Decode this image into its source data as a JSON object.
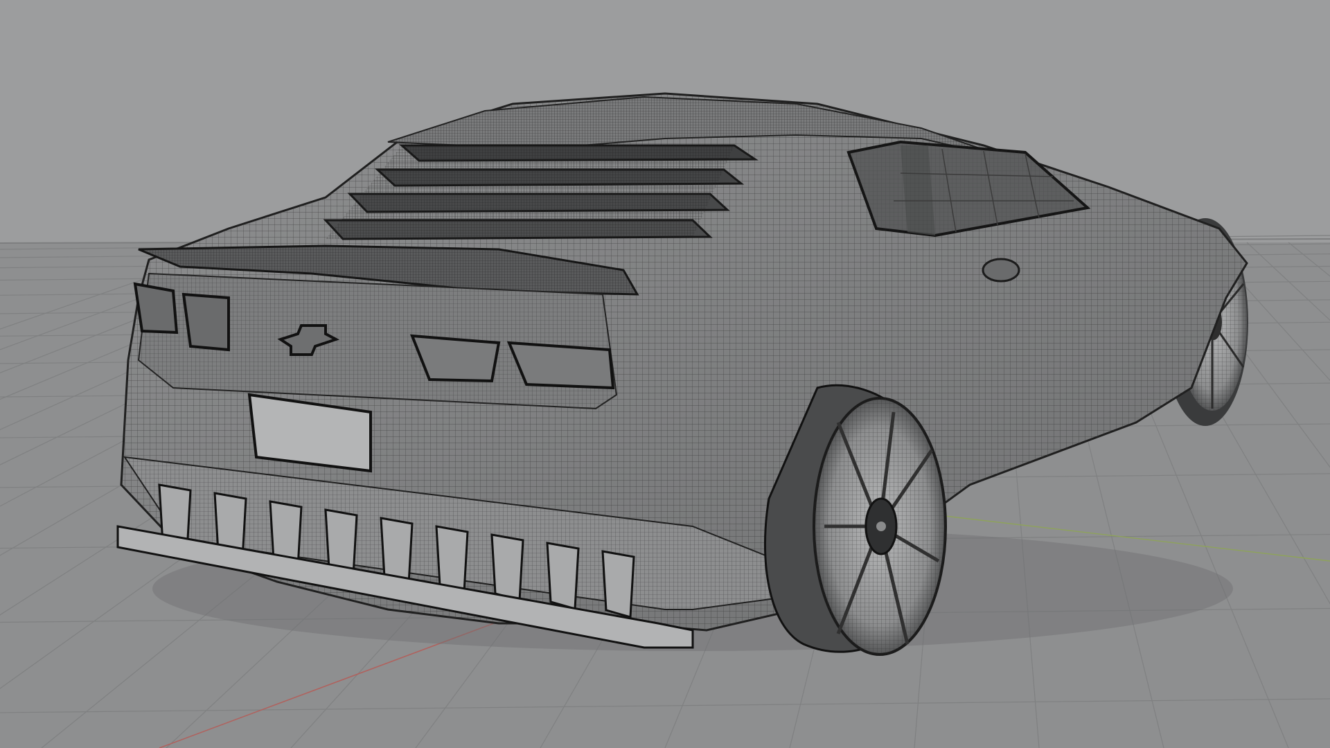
{
  "viewport": {
    "mode": "wireframe-on-shaded",
    "colors": {
      "background": "#9a9b9c",
      "floor": "#8c8d8e",
      "grid_line": "#7e7f80",
      "x_axis": "#b0625e",
      "y_axis": "#8ea35a",
      "body_fill": "#8a8b8c",
      "body_dark": "#4a4b4c",
      "wire": "#2b2b2b",
      "wheel_fill": "#9fa0a1",
      "diffuser_fill": "#a9aaab",
      "plate_fill": "#b4b5b6"
    }
  },
  "model": {
    "object": "car",
    "parts": [
      "body",
      "rear-window-louvers",
      "rear-spoiler",
      "tail-lights",
      "rear-emblem-icon",
      "license-plate",
      "rear-diffuser",
      "rear-wheel",
      "front-wheel",
      "side-window",
      "door-handle"
    ]
  }
}
